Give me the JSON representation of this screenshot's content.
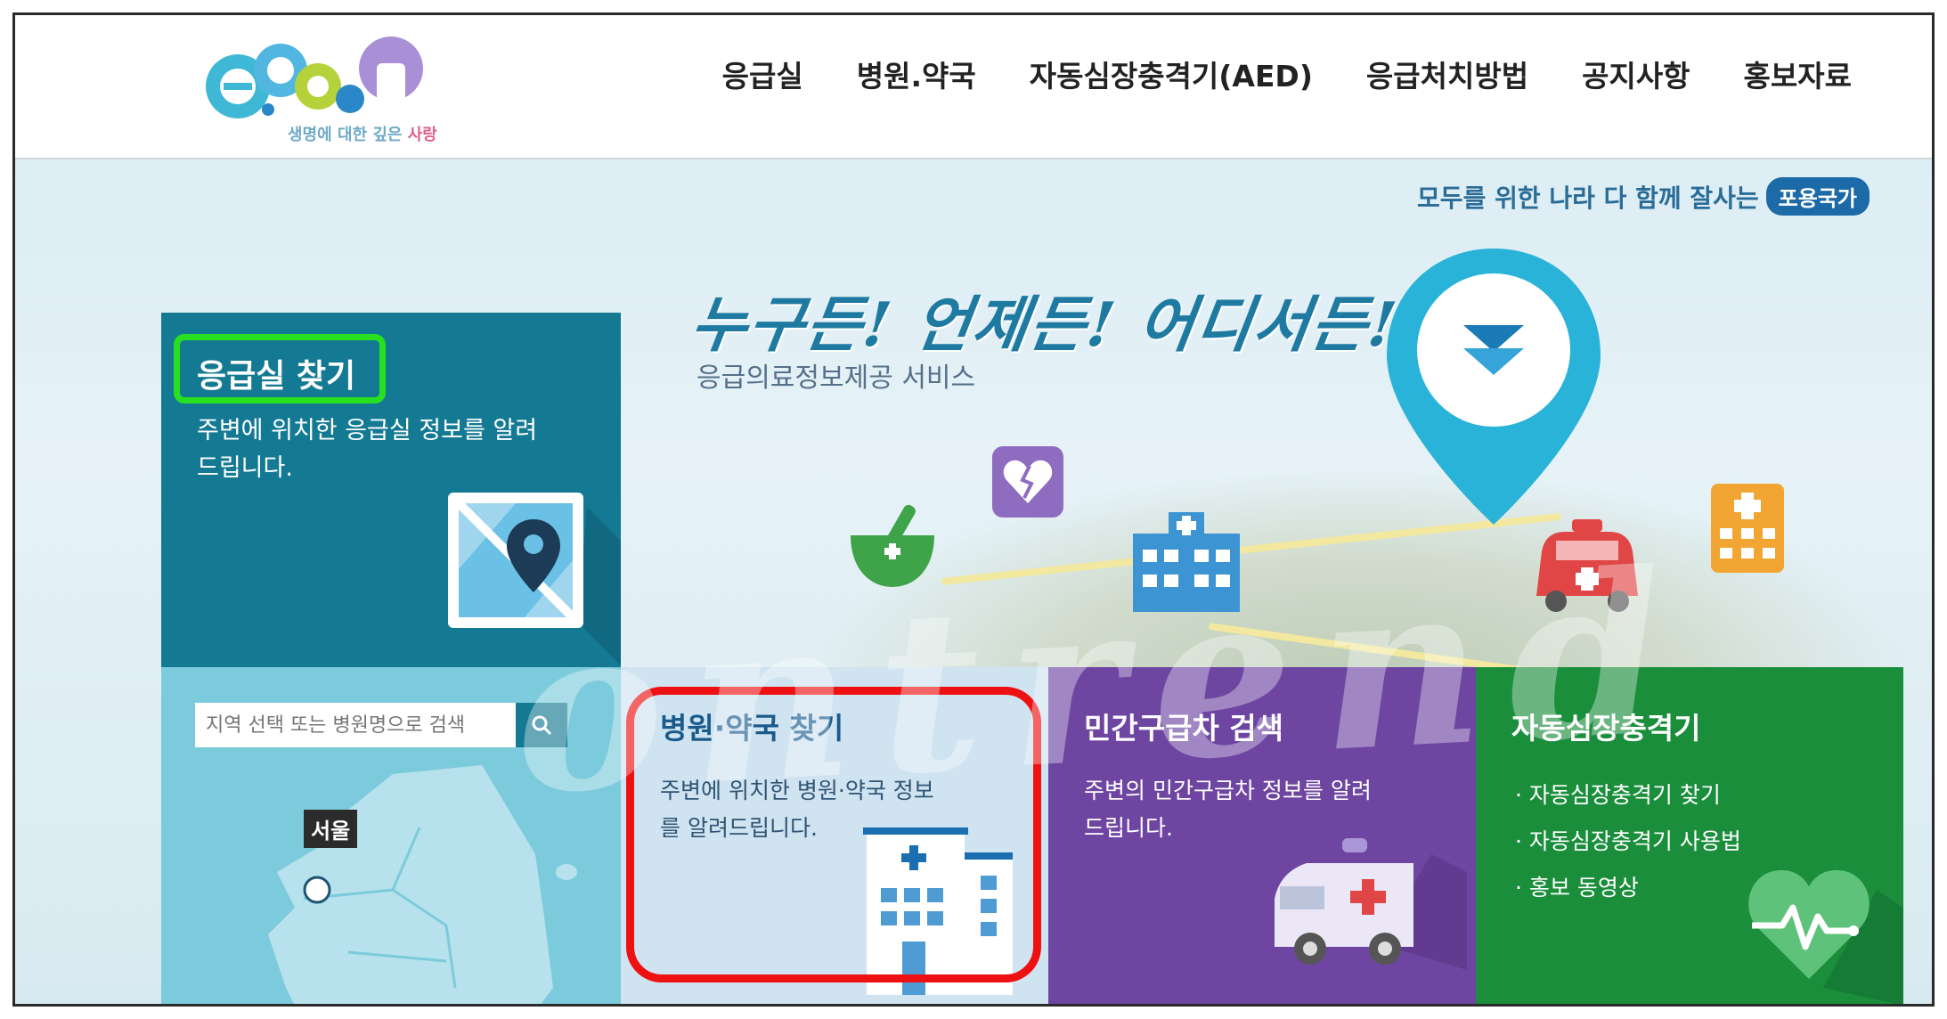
{
  "header": {
    "logo_tagline": "생명에 대한 깊은 사랑",
    "logo_tagline_main": "생명에 대한 깊은 ",
    "logo_tagline_accent": "사랑",
    "nav": [
      "응급실",
      "병원.약국",
      "자동심장충격기(AED)",
      "응급처치방법",
      "공지사항",
      "홍보자료"
    ]
  },
  "hero": {
    "slogan_text": "모두를 위한 나라 다 함께 잘사는",
    "slogan_badge": "포용국가",
    "title": "누구든! 언제든! 어디서든!",
    "subtitle": "응급의료정보제공 서비스",
    "watermark": "ontrend"
  },
  "tiles": {
    "er": {
      "title": "응급실 찾기",
      "desc": "주변에 위치한 응급실 정보를 알려드립니다."
    },
    "search": {
      "placeholder": "지역 선택 또는 병원명으로 검색",
      "region_label": "서울"
    },
    "hospital": {
      "title": "병원·약국 찾기",
      "desc": "주변에 위치한 병원·약국 정보를 알려드립니다."
    },
    "ambulance": {
      "title": "민간구급차 검색",
      "desc": "주변의 민간구급차 정보를 알려드립니다."
    },
    "aed": {
      "title": "자동심장충격기",
      "items": [
        "· 자동심장충격기 찾기",
        "· 자동심장충격기 사용법",
        "· 홍보 동영상"
      ]
    }
  },
  "colors": {
    "er_tile": "#147a93",
    "search_tile": "#7ccbdc",
    "hospital_tile": "#cfe3f1",
    "ambulance_tile": "#6e45a1",
    "aed_tile": "#1b8e3c",
    "highlight_green": "#28e020",
    "highlight_red": "#ee1111"
  }
}
